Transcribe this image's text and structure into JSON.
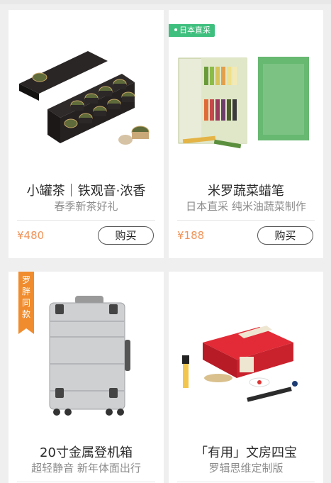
{
  "colors": {
    "price": "#f0945a",
    "badge_green": "#3fbf7e",
    "badge_orange": "#f08c2e"
  },
  "products": [
    {
      "title": "小罐茶｜铁观音·浓香",
      "subtitle": "春季新茶好礼",
      "price": "¥480",
      "buy_label": "购买",
      "image_icon": "tea-gift-box-image"
    },
    {
      "title": "米罗蔬菜蜡笔",
      "subtitle": "日本直采 纯米油蔬菜制作",
      "price": "¥188",
      "buy_label": "购买",
      "badge": "日本直采",
      "image_icon": "vegetable-crayons-image"
    },
    {
      "title": "20寸金属登机箱",
      "subtitle": "超轻静音 新年体面出行",
      "badge_chars": [
        "罗",
        "胖",
        "同",
        "款"
      ],
      "image_icon": "metal-suitcase-image"
    },
    {
      "title": "「有用」文房四宝",
      "subtitle": "罗辑思维定制版",
      "image_icon": "stationery-gift-box-image"
    }
  ]
}
